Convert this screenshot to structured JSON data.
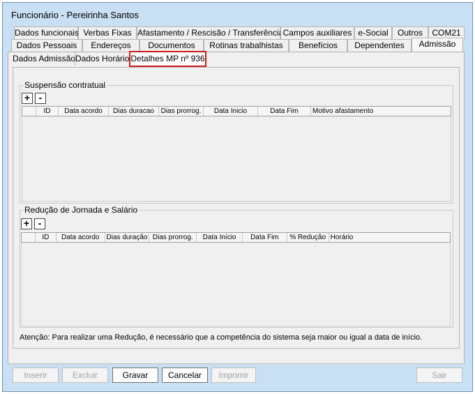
{
  "window": {
    "title": "Funcionário - Pereirinha Santos"
  },
  "tabs_row1": [
    "Dados funcionais",
    "Verbas Fixas",
    "Afastamento / Rescisão / Transferência",
    "Campos auxiliares",
    "e-Social",
    "Outros",
    "COM21"
  ],
  "tabs_row2": [
    "Dados Pessoais",
    "Endereços",
    "Documentos",
    "Rotinas trabalhistas",
    "Benefícios",
    "Dependentes",
    "Admissão"
  ],
  "subtabs": [
    "Dados Admissão",
    "Dados Horário",
    "Detalhes MP nº 936"
  ],
  "suspensao": {
    "title": "Suspensão contratual",
    "add": "+",
    "remove": "-",
    "columns": [
      "",
      "ID",
      "Data acordo",
      "Dias duracao",
      "Dias prorrog.",
      "Data Inicio",
      "Data Fim",
      "Motivo afastamento"
    ]
  },
  "reducao": {
    "title": "Redução de Jornada e Salário",
    "add": "+",
    "remove": "-",
    "columns": [
      "",
      "ID",
      "Data acordo",
      "Dias duração",
      "Dias prorrog.",
      "Data Início",
      "Data Fim",
      "% Redução",
      "Horário"
    ]
  },
  "note": "Atenção: Para realizar uma Redução, é necessário que a competência do sistema seja maior ou igual a data de início.",
  "buttons": {
    "inserir": "Inserir",
    "excluir": "Excluir",
    "gravar": "Gravar",
    "cancelar": "Cancelar",
    "imprimir": "Imprimir",
    "sair": "Sair"
  }
}
